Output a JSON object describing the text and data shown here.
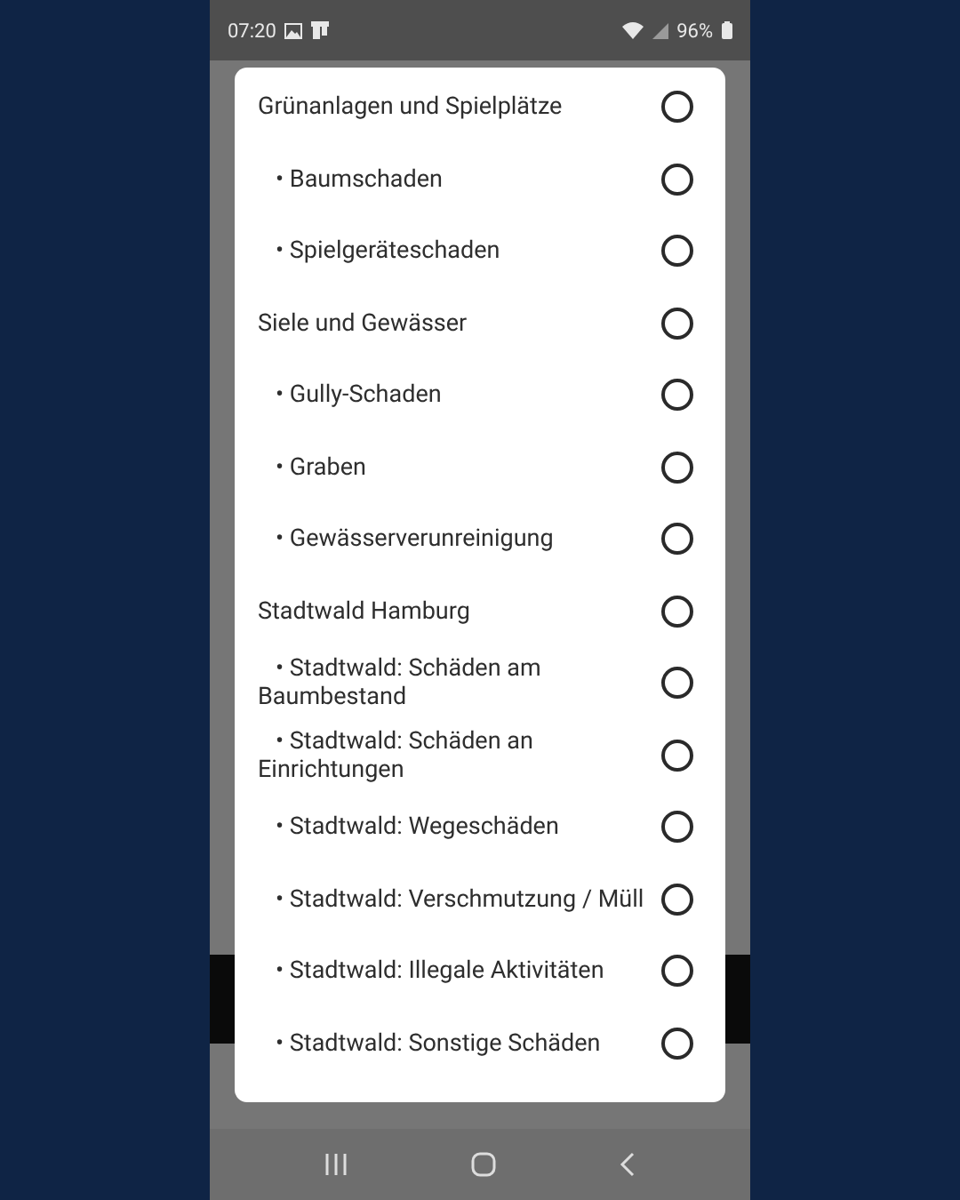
{
  "status_bar": {
    "time": "07:20",
    "battery": "96%"
  },
  "dialog": {
    "options": [
      {
        "kind": "group",
        "label": "Grünanlagen und Spielplätze",
        "selected": false
      },
      {
        "kind": "sub",
        "label": "• Baumschaden",
        "selected": false
      },
      {
        "kind": "sub",
        "label": "• Spielgeräteschaden",
        "selected": false
      },
      {
        "kind": "group",
        "label": "Siele und Gewässer",
        "selected": false
      },
      {
        "kind": "sub",
        "label": "• Gully-Schaden",
        "selected": false
      },
      {
        "kind": "sub",
        "label": "• Graben",
        "selected": false
      },
      {
        "kind": "sub",
        "label": "• Gewässerverunreinigung",
        "selected": false
      },
      {
        "kind": "group",
        "label": "Stadtwald Hamburg",
        "selected": false
      },
      {
        "kind": "sub",
        "label": "• Stadtwald: Schäden am Baumbestand",
        "selected": false
      },
      {
        "kind": "sub",
        "label": "• Stadtwald: Schäden an Einrichtungen",
        "selected": false
      },
      {
        "kind": "sub",
        "label": "• Stadtwald: Wegeschäden",
        "selected": false
      },
      {
        "kind": "sub",
        "label": "• Stadtwald: Verschmutzung / Müll",
        "selected": false
      },
      {
        "kind": "sub",
        "label": "• Stadtwald: Illegale Aktivitäten",
        "selected": false
      },
      {
        "kind": "sub",
        "label": "• Stadtwald: Sonstige Schäden",
        "selected": false
      }
    ]
  }
}
